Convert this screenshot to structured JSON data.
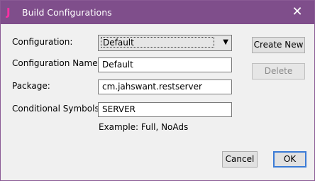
{
  "window": {
    "title": "Build Configurations",
    "app_icon_glyph": "J",
    "close_glyph": "✕"
  },
  "form": {
    "configuration_label": "Configuration:",
    "configuration_value": "Default",
    "configuration_name_label": "Configuration Name:",
    "configuration_name_value": "Default",
    "package_label": "Package:",
    "package_value": "cm.jahswant.restserver",
    "conditional_symbols_label": "Conditional Symbols:",
    "conditional_symbols_value": "SERVER",
    "example_text": "Example: Full, NoAds"
  },
  "buttons": {
    "create_new": "Create New",
    "delete": "Delete",
    "cancel": "Cancel",
    "ok": "OK"
  },
  "colors": {
    "titlebar": "#7f4e8b",
    "app_icon": "#ff2fa4",
    "ok_border": "#3b7bd6"
  }
}
